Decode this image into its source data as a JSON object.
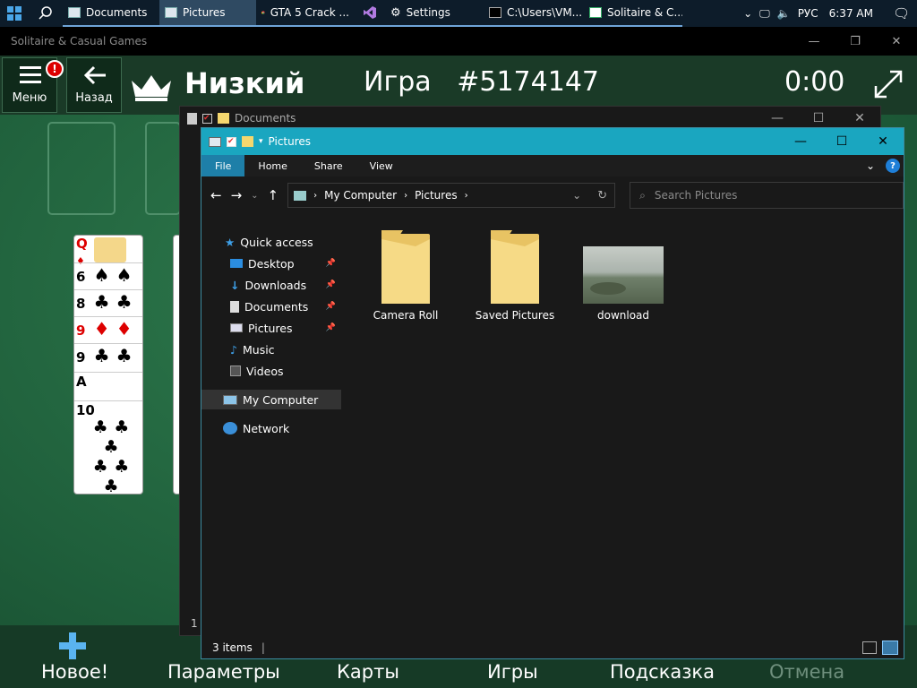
{
  "taskbar": {
    "items": [
      {
        "label": "Documents"
      },
      {
        "label": "Pictures"
      },
      {
        "label": "GTA 5 Crack ..."
      },
      {
        "label": "Settings"
      },
      {
        "label": "C:\\Users\\VM..."
      },
      {
        "label": "Solitaire & C..."
      }
    ],
    "lang": "РУС",
    "time": "6:37 AM"
  },
  "solitaire": {
    "window_title": "Solitaire & Casual Games",
    "menu_label": "Меню",
    "badge": "!",
    "back_label": "Назад",
    "difficulty": "Низкий",
    "game_label": "Игра",
    "game_number": "#5174147",
    "timer": "0:00",
    "bottom": {
      "new": "Новое!",
      "settings": "Параметры",
      "cards": "Карты",
      "games": "Игры",
      "hint": "Подсказка",
      "undo": "Отмена"
    },
    "cards": [
      {
        "rank": "Q",
        "suit": "♦"
      },
      {
        "rank": "6",
        "suit": "♠"
      },
      {
        "rank": "8",
        "suit": "♣"
      },
      {
        "rank": "9",
        "suit": "♦"
      },
      {
        "rank": "9",
        "suit": "♣"
      },
      {
        "rank": "A",
        "suit": "♣"
      },
      {
        "rank": "10",
        "suit": "♣"
      }
    ]
  },
  "documents_window": {
    "title": "Documents",
    "status_fragment": "1"
  },
  "pictures_window": {
    "title": "Pictures",
    "ribbon_tabs": [
      "File",
      "Home",
      "Share",
      "View"
    ],
    "breadcrumb": [
      "My Computer",
      "Pictures"
    ],
    "search_placeholder": "Search Pictures",
    "nav": {
      "quick_access": "Quick access",
      "desktop": "Desktop",
      "downloads": "Downloads",
      "documents": "Documents",
      "pictures": "Pictures",
      "music": "Music",
      "videos": "Videos",
      "my_computer": "My Computer",
      "network": "Network"
    },
    "files": [
      {
        "name": "Camera Roll"
      },
      {
        "name": "Saved Pictures"
      },
      {
        "name": "download"
      }
    ],
    "status": "3 items"
  }
}
